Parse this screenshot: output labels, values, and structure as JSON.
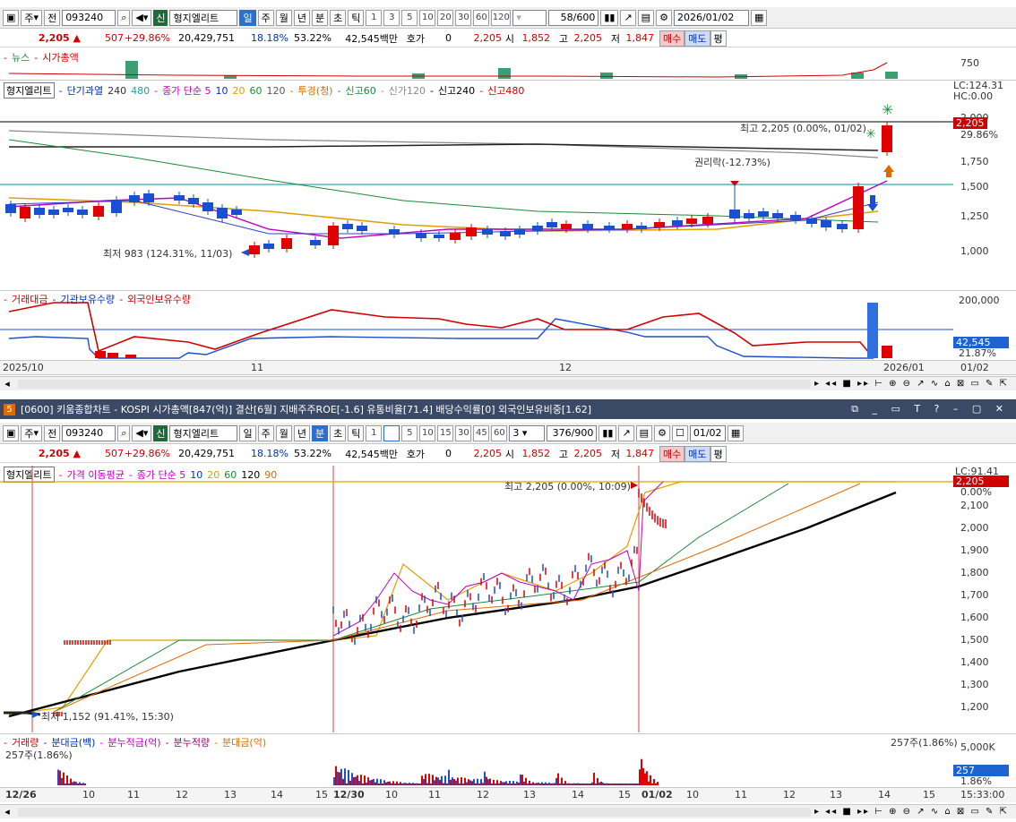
{
  "top_window": {
    "toolbar": {
      "type1": "주",
      "type2": "전",
      "code": "093240",
      "company": "형지엘리트",
      "periods": [
        "일",
        "주",
        "월",
        "년",
        "분",
        "초",
        "틱"
      ],
      "active_period": "일",
      "minutes": [
        "1",
        "3",
        "5",
        "10",
        "20",
        "30",
        "60",
        "120"
      ],
      "count": "58",
      "count_total": "/600",
      "date": "2026/01/02",
      "new_tag": "신"
    },
    "quote": {
      "price": "2,205",
      "change": "507",
      "change_pct": "+29.86%",
      "volume": "20,429,751",
      "turnover_pct": "18.18%",
      "ratio2": "53.22%",
      "amount": "42,545백만",
      "hoga_label": "호가",
      "hoga_val": "0",
      "hoga_price": "2,205",
      "open_label": "시",
      "open": "1,852",
      "high_label": "고",
      "high": "2,205",
      "low_label": "저",
      "low": "1,847",
      "buy": "매수",
      "sell": "매도",
      "eval": "평"
    },
    "news_panel": {
      "label1": "뉴스",
      "label2": "시가총액",
      "axis": "750"
    },
    "price_panel": {
      "legend": [
        "형지엘리트",
        "단기과열",
        "240",
        "480",
        "종가 단순 5",
        "10",
        "20",
        "60",
        "120",
        "투경(청)",
        "신고60",
        "신가120",
        "신고240",
        "신고480"
      ],
      "lc": "LC:124.31",
      "hc": "HC:0.00",
      "y_ticks": [
        "2,000",
        "1,750",
        "1,500",
        "1,250",
        "1,000"
      ],
      "last_price": "2,205",
      "last_pct": "29.86%",
      "high_note": "최고 2,205 (0.00%, 01/02)",
      "low_note": "최저 983 (124.31%, 11/03)",
      "event_note": "권리락(-12.73%)"
    },
    "volume_panel": {
      "legend": [
        "거래대금",
        "기관보유수량",
        "외국인보유수량"
      ],
      "y_max": "200,000",
      "val": "42,545",
      "pct": "21.87%"
    },
    "x_axis": [
      "2025/10",
      "11",
      "12",
      "2026/01",
      "01/02"
    ]
  },
  "bottom_window": {
    "title": "[0600] 키움종합차트 - KOSPI 시가총액[847(억)] 결산[6월] 지배주주ROE[-1.6] 유통비율[71.4] 배당수익률[0] 외국인보유비중[1.62]",
    "badge": "5",
    "toolbar": {
      "type1": "주",
      "type2": "전",
      "code": "093240",
      "company": "형지엘리트",
      "periods": [
        "일",
        "주",
        "월",
        "년",
        "분",
        "초",
        "틱"
      ],
      "active_period": "분",
      "minutes": [
        "1",
        "3",
        "5",
        "10",
        "15",
        "30",
        "45",
        "60"
      ],
      "active_minute": "3",
      "unit": "3",
      "count": "376",
      "count_total": "/900",
      "date": "01/02",
      "new_tag": "신"
    },
    "quote": {
      "price": "2,205",
      "change": "507",
      "change_pct": "+29.86%",
      "volume": "20,429,751",
      "turnover_pct": "18.18%",
      "ratio2": "53.22%",
      "amount": "42,545백만",
      "hoga_label": "호가",
      "hoga_val": "0",
      "hoga_price": "2,205",
      "open_label": "시",
      "open": "1,852",
      "high_label": "고",
      "high": "2,205",
      "low_label": "저",
      "low": "1,847",
      "buy": "매수",
      "sell": "매도",
      "eval": "평"
    },
    "price_panel": {
      "legend": [
        "형지엘리트",
        "가격 이동평균",
        "종가 단순 5",
        "10",
        "20",
        "60",
        "120",
        "90"
      ],
      "lc": "LC:91.41",
      "last_price": "2,205",
      "last_pct": "0.00%",
      "y_ticks": [
        "2,100",
        "2,000",
        "1,900",
        "1,800",
        "1,700",
        "1,600",
        "1,500",
        "1,400",
        "1,300",
        "1,200"
      ],
      "high_note": "최고 2,205 (0.00%, 10:09)",
      "low_note": "최저 1,152 (91.41%, 15:30)"
    },
    "volume_panel": {
      "legend": [
        "거래량",
        "분대금(백)",
        "분누적금(억)",
        "분누적량",
        "분대금(억)"
      ],
      "left_note": "257주(1.86%)",
      "right_note": "257주(1.86%)",
      "y_max": "5,000K",
      "val": "257",
      "pct": "1.86%"
    },
    "x_axis": [
      "12/26",
      "10",
      "11",
      "12",
      "13",
      "14",
      "15",
      "12/30",
      "10",
      "11",
      "12",
      "13",
      "14",
      "15",
      "01/02",
      "10",
      "11",
      "12",
      "13",
      "14",
      "15"
    ],
    "time": "15:33:00"
  },
  "colors": {
    "up": "#e00000",
    "down": "#1a4fd0",
    "accent_green": "#1e6b3a"
  }
}
